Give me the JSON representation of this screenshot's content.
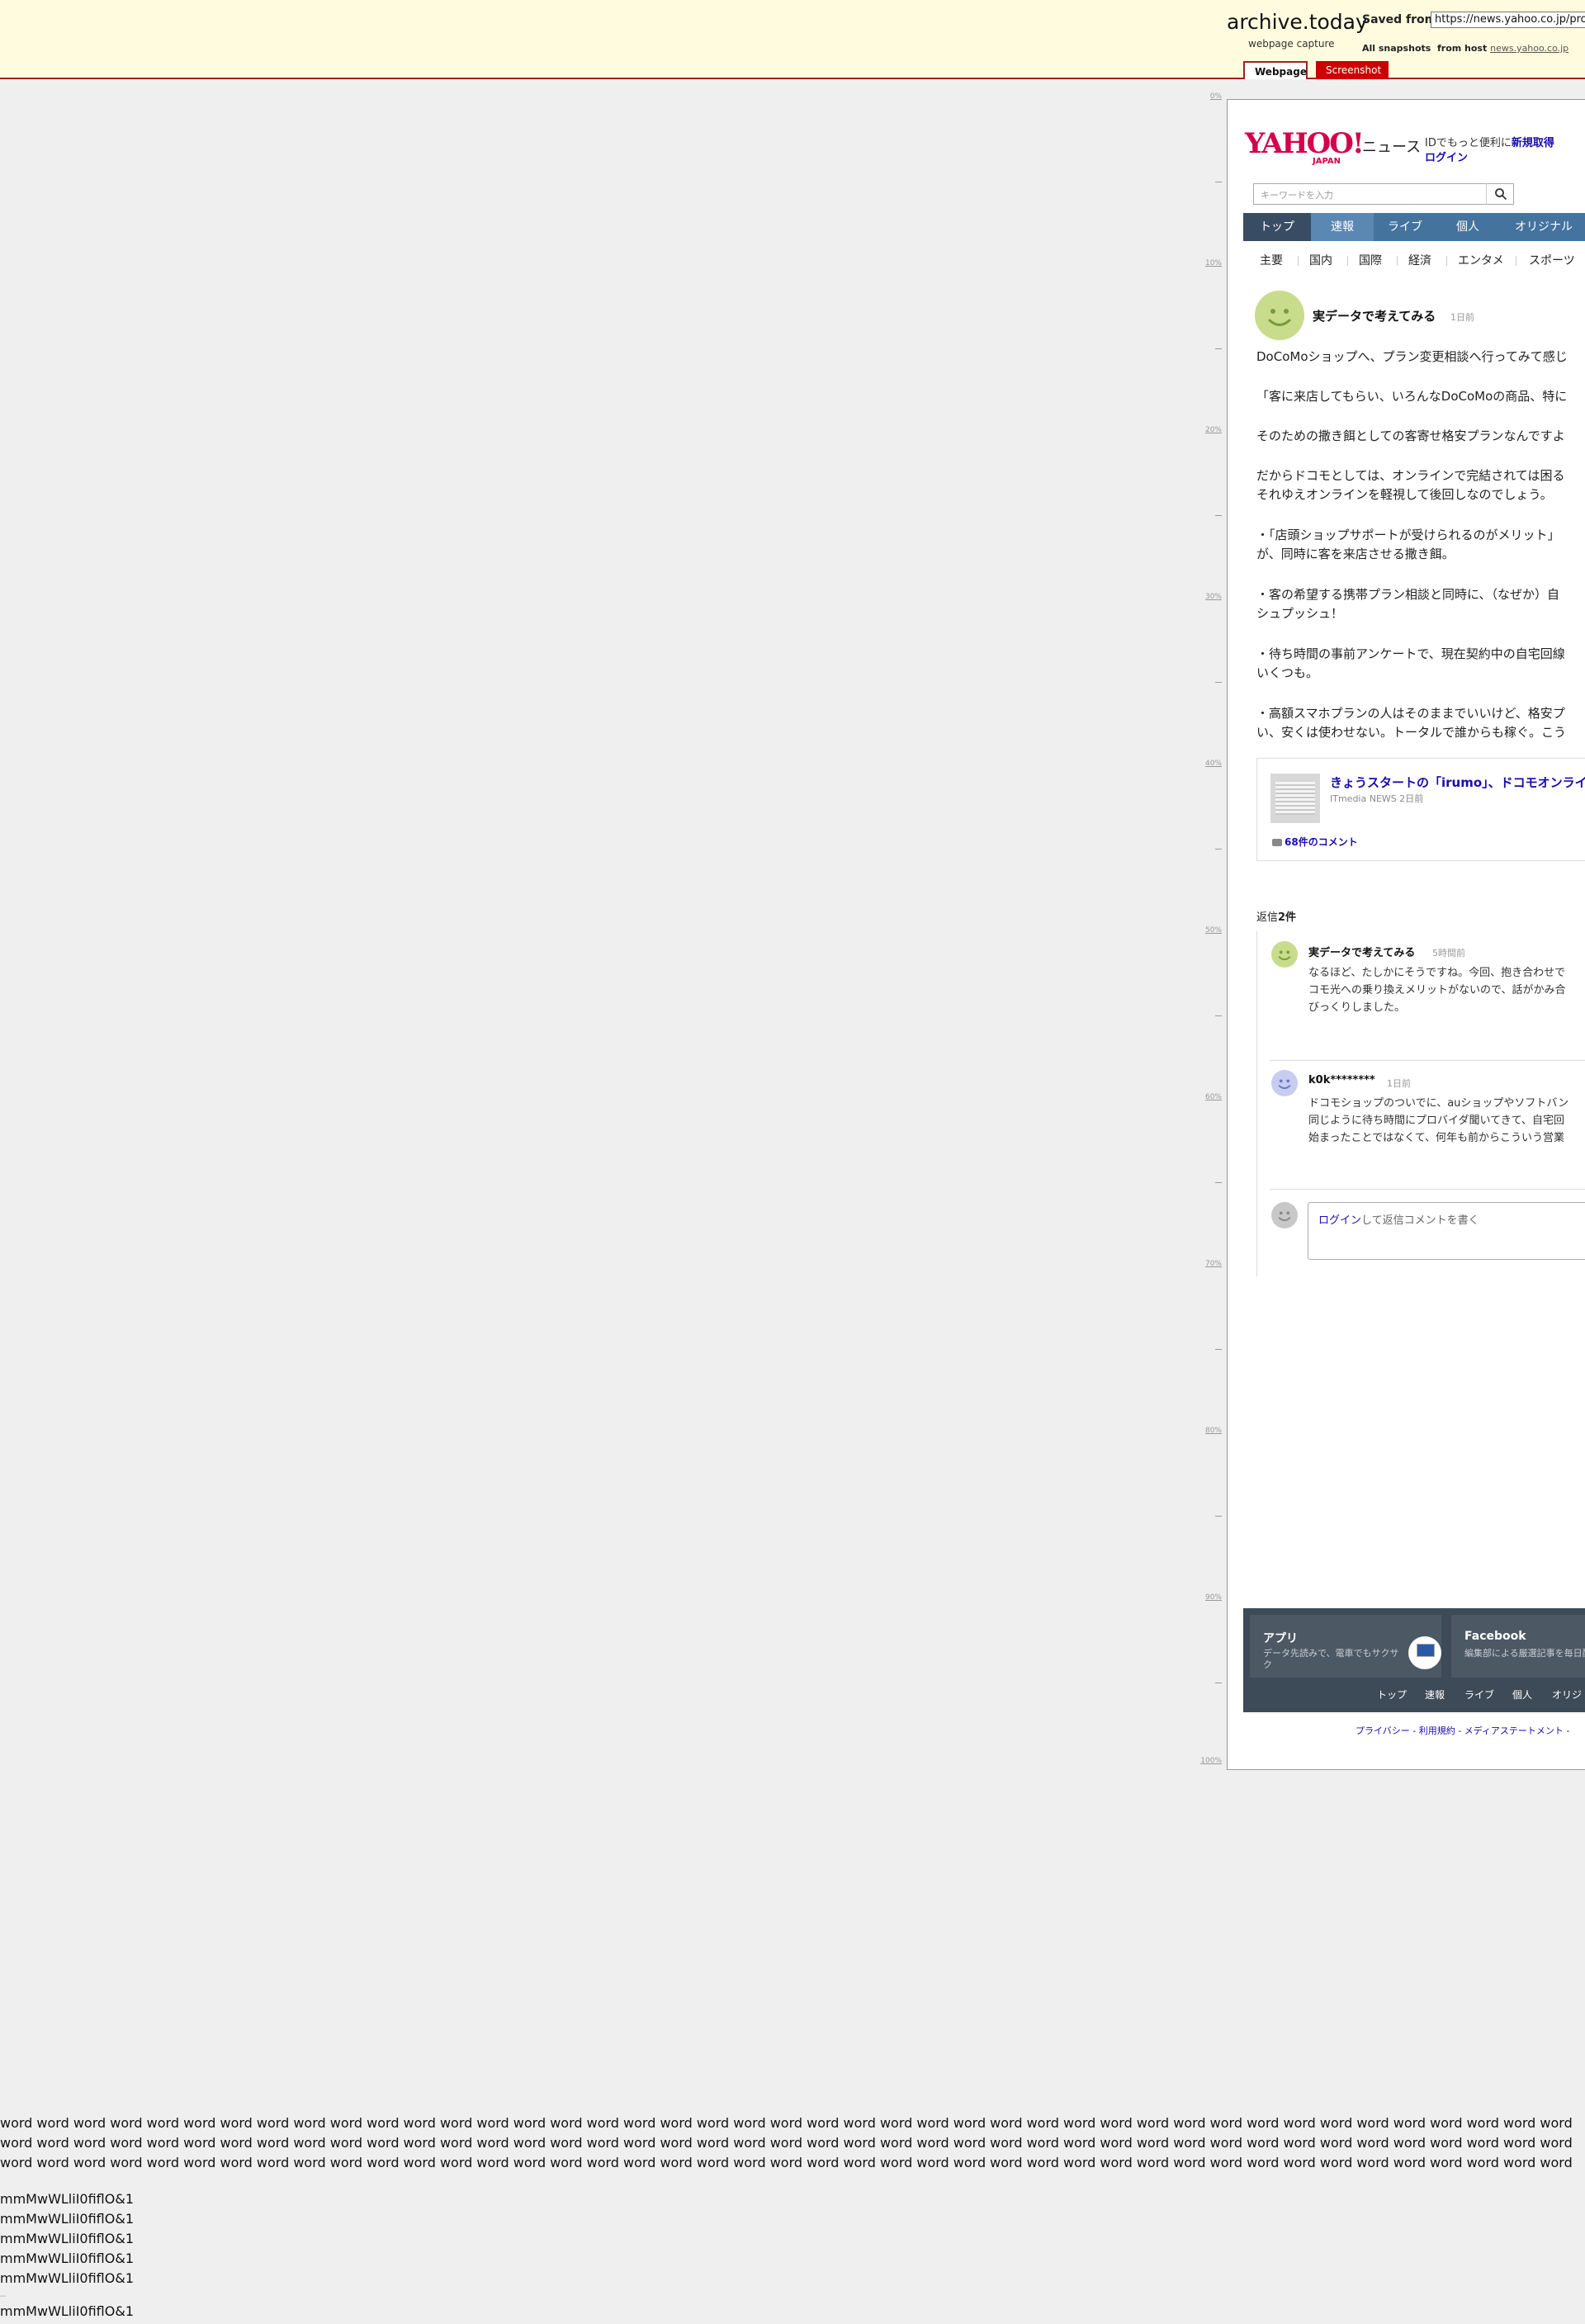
{
  "archive": {
    "logo": "archive.today",
    "subtitle": "webpage capture",
    "saved_from_label": "Saved from",
    "url": "https://news.yahoo.co.jp/profile/comments",
    "all_snapshots_label": "All snapshots",
    "from_host_label": "from host",
    "host": "news.yahoo.co.jp",
    "tabs": [
      "Webpage",
      "Screenshot"
    ]
  },
  "ruler": {
    "labels": [
      "0%",
      "10%",
      "20%",
      "30%",
      "40%",
      "50%",
      "60%",
      "70%",
      "80%",
      "90%",
      "100%"
    ]
  },
  "yahoo": {
    "logo_text": "YAHOO!",
    "logo_sub": "JAPAN",
    "service_name": "ニュース",
    "id_text": "IDでもっと便利に",
    "signup_link": "新規取得",
    "login_link": "ログイン",
    "search_placeholder": "キーワードを入力",
    "nav": [
      "トップ",
      "速報",
      "ライブ",
      "個人",
      "オリジナル"
    ],
    "subnav": [
      "主要",
      "国内",
      "国際",
      "経済",
      "エンタメ",
      "スポーツ"
    ]
  },
  "comment": {
    "author": "実データで考えてみる",
    "time": "1日前",
    "lines": [
      "DoCoMoショップへ、プラン変更相談へ行ってみて感じ",
      "「客に来店してもらい、いろんなDoCoMoの商品、特に",
      "そのための撒き餌としての客寄せ格安プランなんですよ",
      "だからドコモとしては、オンラインで完結されては困る",
      "それゆえオンラインを軽視して後回しなのでしょう。",
      "・「店頭ショップサポートが受けられるのがメリット」",
      "が、同時に客を来店させる撒き餌。",
      "・客の希望する携帯プラン相談と同時に、（なぜか）自",
      "シュプッシュ！",
      "・待ち時間の事前アンケートで、現在契約中の自宅回線",
      "いくつも。",
      "・高額スマホプランの人はそのままでいいけど、格安プ",
      "い、安くは使わせない。トータルで誰からも稼ぐ。こう"
    ],
    "article": {
      "title": "きょうスタートの「irumo」、ドコモオンライ",
      "source": "ITmedia NEWS 2日前",
      "comments": "68件のコメント"
    },
    "replies_prefix": "返信",
    "replies_count": "2件",
    "replies": [
      {
        "author": "実データで考えてみる",
        "time": "5時間前",
        "lines": [
          "なるほど、たしかにそうですね。今回、抱き合わせで",
          "コモ光への乗り換えメリットがないので、話がかみ合",
          "びっくりしました。"
        ]
      },
      {
        "author": "k0k********",
        "time": "1日前",
        "lines": [
          "ドコモショップのついでに、auショップやソフトバン",
          "同じように待ち時間にプロバイダ聞いてきて、自宅回",
          "始まったことではなくて、何年も前からこういう営業"
        ]
      }
    ],
    "reply_input_link": "ログイン",
    "reply_input_text": "して返信コメントを書く"
  },
  "footer": {
    "app_title": "アプリ",
    "app_desc": "データ先読みで、電車でもサクサク",
    "fb_title": "Facebook",
    "fb_desc": "編集部による厳選記事を毎日配信",
    "nav": [
      "トップ",
      "速報",
      "ライブ",
      "個人",
      "オリジ"
    ],
    "links": "プライバシー - 利用規約 - メディアステートメント -"
  },
  "test_text": {
    "words": "word word word word word word word word word word word word word word word word word word word word word word word word word word word word word word word word word word word word word word word word word word word word word word word word word word word word word word word word word word word word word word word word word word word word word word word word word word word word word word word word word word word word word word word word word word word word word word word word word word word word word word word word word word word word word word word word word word word word word word word word word word word word word word word word word word word word word word word word word word word word word",
    "mm_line": "mmMwWLliI0fiflO&1",
    "dash": "--"
  }
}
